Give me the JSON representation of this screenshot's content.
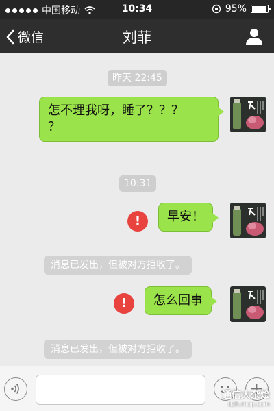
{
  "statusbar": {
    "carrier": "中国移动",
    "time": "10:34",
    "battery_text": "95%",
    "battery_level": 0.95
  },
  "navbar": {
    "back_label": "微信",
    "title": "刘菲"
  },
  "messages": [
    {
      "timestamp": "昨天 22:45",
      "text": "怎不理我呀，睡了？？？\n？"
    },
    {
      "timestamp": "10:31",
      "text": "早安！",
      "system_notice": "消息已发出，但被对方拒收了。"
    },
    {
      "text": "怎么回事",
      "system_notice": "消息已发出，但被对方拒收了。"
    }
  ],
  "input": {
    "placeholder": ""
  },
  "watermark": {
    "main": "通信大杂烩",
    "sub": "dzh.mop.com"
  },
  "colors": {
    "bubble": "#9be34a",
    "error": "#e8433e",
    "navbar": "#2e2e2e"
  }
}
